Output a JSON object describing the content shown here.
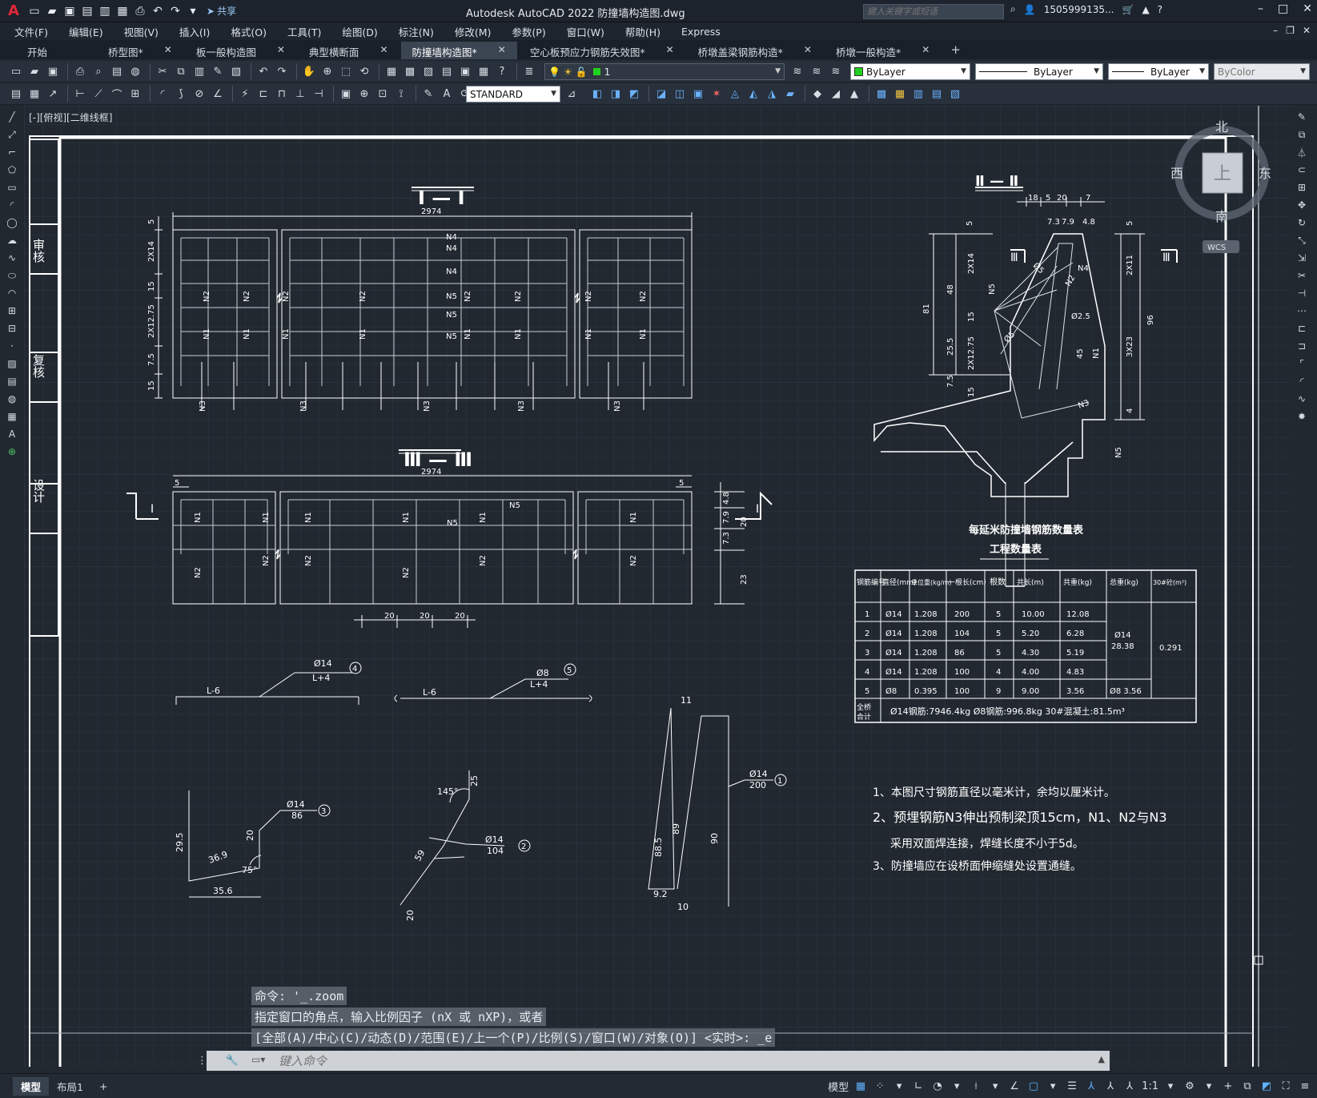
{
  "app": {
    "logo": "A",
    "title": "Autodesk AutoCAD 2022    防撞墙构造图.dwg",
    "share_label": "共享",
    "search_placeholder": "键入关键字或短语",
    "user": "1505999135...",
    "window_controls": [
      "–",
      "□",
      "✕"
    ]
  },
  "menu": [
    "文件(F)",
    "编辑(E)",
    "视图(V)",
    "插入(I)",
    "格式(O)",
    "工具(T)",
    "绘图(D)",
    "标注(N)",
    "修改(M)",
    "参数(P)",
    "窗口(W)",
    "帮助(H)",
    "Express"
  ],
  "tabs": [
    {
      "label": "开始",
      "closable": false
    },
    {
      "label": "桥型图*",
      "closable": true
    },
    {
      "label": "板一般构造图",
      "closable": true
    },
    {
      "label": "典型横断面",
      "closable": true
    },
    {
      "label": "防撞墙构造图*",
      "closable": true,
      "active": true
    },
    {
      "label": "空心板预应力钢筋失效图*",
      "closable": true
    },
    {
      "label": "桥墩盖梁钢筋构造*",
      "closable": true
    },
    {
      "label": "桥墩一般构造*",
      "closable": true
    }
  ],
  "toolbar": {
    "layer_value": "1",
    "color_value": "ByLayer",
    "linetype_value": "ByLayer",
    "lineweight_value": "ByLayer",
    "plotstyle_value": "ByColor",
    "textstyle_value": "STANDARD"
  },
  "viewport_label": "[-][俯视][二维线框]",
  "viewcube": {
    "north": "北",
    "south": "南",
    "east": "东",
    "west": "西",
    "top": "上",
    "wcs": "WCS"
  },
  "drawing": {
    "title_block": [
      "审核",
      "复核",
      "设计"
    ],
    "section_1_title": "Ⅰ — Ⅰ",
    "section_2_title": "Ⅱ — Ⅱ",
    "section_3_title": "Ⅲ — Ⅲ",
    "dim_2974": "2974",
    "table_title_1": "每延米防撞墙钢筋数量表",
    "table_title_2": "工程数量表",
    "table_header": [
      "钢筋编号",
      "直径(mm)",
      "单位重(kg/m)",
      "一根长(cm)",
      "根数",
      "共长(m)",
      "共重(kg)",
      "总重(kg)",
      "30#砼(m³)"
    ],
    "table_rows": [
      [
        "1",
        "Ø14",
        "1.208",
        "200",
        "5",
        "10.00",
        "12.08"
      ],
      [
        "2",
        "Ø14",
        "1.208",
        "104",
        "5",
        "5.20",
        "6.28"
      ],
      [
        "3",
        "Ø14",
        "1.208",
        "86",
        "5",
        "4.30",
        "5.19"
      ],
      [
        "4",
        "Ø14",
        "1.208",
        "100",
        "4",
        "4.00",
        "4.83"
      ],
      [
        "5",
        "Ø8",
        "0.395",
        "100",
        "9",
        "9.00",
        "3.56"
      ]
    ],
    "total_phi14": "Ø14",
    "total_phi14_value": "28.38",
    "total_phi8": "Ø8 3.56",
    "concrete": "0.291",
    "total_label": "全桥合计",
    "total_text": "Ø14钢筋:7946.4kg  Ø8钢筋:996.8kg  30#混凝土:81.5m³",
    "notes": [
      "1、本图尺寸钢筋直径以毫米计，余均以厘米计。",
      "2、预埋钢筋N3伸出预制梁顶15cm，N1、N2与N3",
      "采用双面焊连接，焊缝长度不小于5d。",
      "3、防撞墙应在设桥面伸缩缝处设置通缝。"
    ]
  },
  "command": {
    "history": [
      "命令: '_.zoom",
      "指定窗口的角点，输入比例因子 (nX 或 nXP)，或者",
      "[全部(A)/中心(C)/动态(D)/范围(E)/上一个(P)/比例(S)/窗口(W)/对象(O)] <实时>: _e"
    ],
    "placeholder": "键入命令"
  },
  "status": {
    "layout_tabs": [
      "模型",
      "布局1"
    ],
    "model_label": "模型",
    "scale": "1:1"
  }
}
